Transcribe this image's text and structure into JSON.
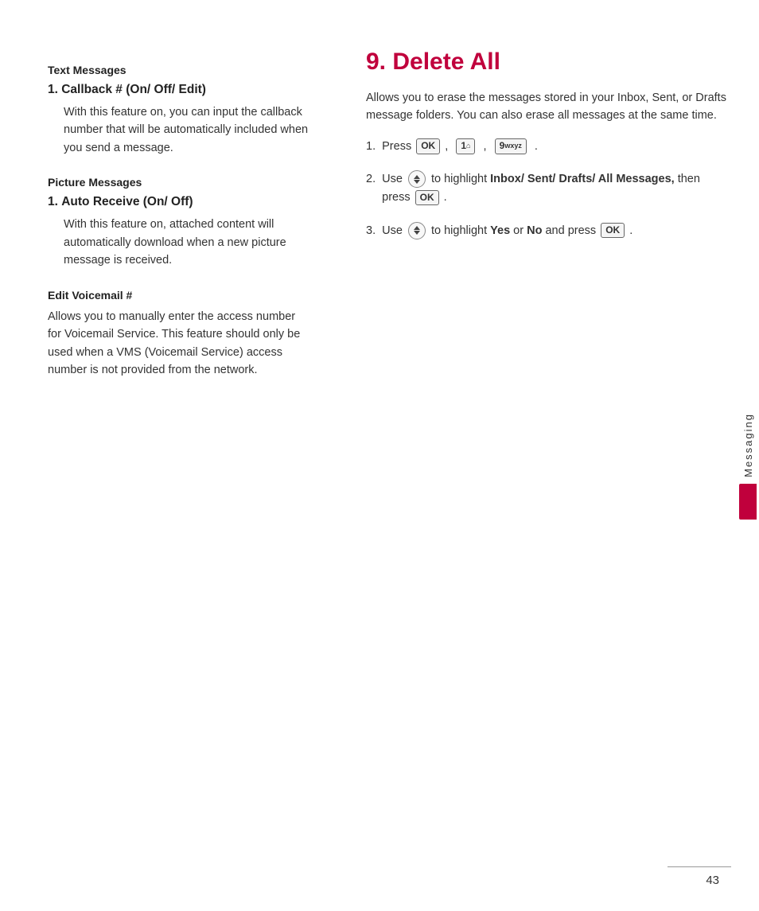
{
  "left": {
    "sections": [
      {
        "type": "header",
        "text": "Text Messages"
      },
      {
        "type": "item",
        "number": "1.",
        "title": "Callback # (On/ Off/ Edit)",
        "body": "With this feature on, you can input the callback number that will be automatically included when you send a message."
      },
      {
        "type": "header",
        "text": "Picture Messages"
      },
      {
        "type": "item",
        "number": "1.",
        "title": "Auto Receive (On/ Off)",
        "body": "With this feature on, attached content will automatically download when a new picture message is received."
      },
      {
        "type": "header",
        "text": "Edit Voicemail #"
      },
      {
        "type": "body",
        "text": "Allows you to manually enter the access number for Voicemail Service. This feature should only be used when a VMS (Voicemail Service) access number is not provided from the network."
      }
    ]
  },
  "right": {
    "heading": "9. Delete All",
    "intro": "Allows you to erase the messages stored in your Inbox, Sent, or Drafts message folders. You can also erase all messages at the same time.",
    "steps": [
      {
        "num": "1.",
        "parts": [
          {
            "type": "text",
            "value": "Press "
          },
          {
            "type": "btn",
            "value": "OK"
          },
          {
            "type": "text",
            "value": " ,  "
          },
          {
            "type": "btn",
            "value": "1⌂"
          },
          {
            "type": "text",
            "value": "  ,  "
          },
          {
            "type": "btn",
            "value": "9wxyz"
          },
          {
            "type": "text",
            "value": "  ."
          }
        ]
      },
      {
        "num": "2.",
        "parts": [
          {
            "type": "text",
            "value": "Use "
          },
          {
            "type": "nav"
          },
          {
            "type": "text",
            "value": " to highlight "
          },
          {
            "type": "bold",
            "value": "Inbox/ Sent/ Drafts/ All Messages,"
          },
          {
            "type": "text",
            "value": " then press "
          },
          {
            "type": "btn",
            "value": "OK"
          },
          {
            "type": "text",
            "value": " ."
          }
        ]
      },
      {
        "num": "3.",
        "parts": [
          {
            "type": "text",
            "value": "Use "
          },
          {
            "type": "nav"
          },
          {
            "type": "text",
            "value": " to highlight "
          },
          {
            "type": "bold",
            "value": "Yes"
          },
          {
            "type": "text",
            "value": " or "
          },
          {
            "type": "bold",
            "value": "No"
          },
          {
            "type": "text",
            "value": " and press "
          },
          {
            "type": "btn",
            "value": "OK"
          },
          {
            "type": "text",
            "value": " ."
          }
        ]
      }
    ]
  },
  "sidebar": {
    "text": "Messaging"
  },
  "page_number": "43"
}
